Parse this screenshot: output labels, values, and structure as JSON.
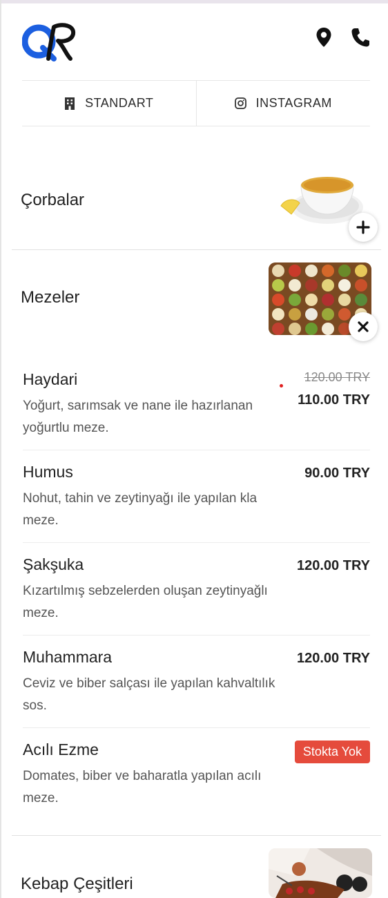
{
  "header": {
    "logo_text": "QR",
    "icons": [
      "map-marker-icon",
      "phone-icon"
    ]
  },
  "nav": {
    "tabs": [
      {
        "label": "STANDART",
        "icon": "building-icon"
      },
      {
        "label": "INSTAGRAM",
        "icon": "instagram-icon"
      }
    ]
  },
  "categories": [
    {
      "title": "Çorbalar",
      "expanded": false
    },
    {
      "title": "Mezeler",
      "expanded": true
    },
    {
      "title": "Kebap Çeşitleri",
      "expanded": false
    }
  ],
  "items": [
    {
      "name": "Haydari",
      "desc": "Yoğurt, sarımsak ve nane ile hazırlanan yoğurtlu meze.",
      "old_price": "120.00 TRY",
      "price": "110.00 TRY"
    },
    {
      "name": "Humus",
      "desc": "Nohut, tahin ve zeytinyağı ile yapılan kla meze.",
      "price": "90.00 TRY"
    },
    {
      "name": "Şakşuka",
      "desc": "Kızartılmış sebzelerden oluşan zeytinyağlı meze.",
      "price": "120.00 TRY"
    },
    {
      "name": "Muhammara",
      "desc": "Ceviz ve biber salçası ile yapılan kahvaltılık sos.",
      "price": "120.00 TRY"
    },
    {
      "name": "Acılı Ezme",
      "desc": "Domates, biber ve baharatla yapılan acılı meze.",
      "badge": "Stokta Yok"
    }
  ],
  "colors": {
    "logo_blue": "#1c5fe0",
    "badge_red": "#e54b3c",
    "discount_dot": "#e02020"
  }
}
